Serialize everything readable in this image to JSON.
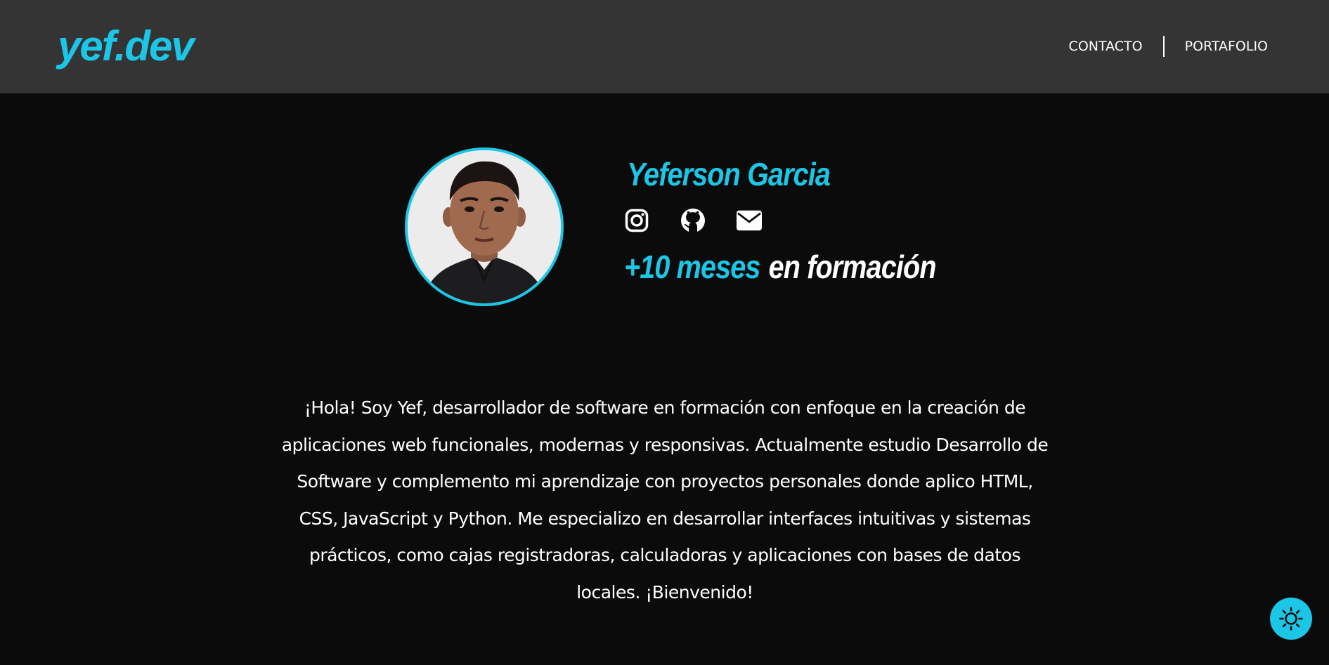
{
  "header": {
    "logo_text": "yef.dev",
    "nav": {
      "contact_label": "CONTACTO",
      "portfolio_label": "PORTAFOLIO"
    }
  },
  "profile": {
    "name": "Yeferson Garcia",
    "socials": [
      {
        "icon": "instagram-icon"
      },
      {
        "icon": "github-icon"
      },
      {
        "icon": "envelope-icon"
      }
    ],
    "experience_highlight": "+10 meses",
    "experience_rest": "en formación"
  },
  "bio": {
    "text": "¡Hola! Soy Yef, desarrollador de software en formación con enfoque en la creación de aplicaciones web funcionales, modernas y responsivas. Actualmente estudio Desarrollo de Software y complemento mi aprendizaje con proyectos personales donde aplico HTML, CSS, JavaScript y Python. Me especializo en desarrollar interfaces intuitivas y sistemas prácticos, como cajas registradoras, calculadoras y aplicaciones con bases de datos locales. ¡Bienvenido!"
  },
  "theme_toggle": {
    "icon": "sun-icon"
  },
  "colors": {
    "accent": "#1cc6e6",
    "header_bg": "#353435",
    "page_bg": "#0b0b0b",
    "text": "#ffffff"
  }
}
